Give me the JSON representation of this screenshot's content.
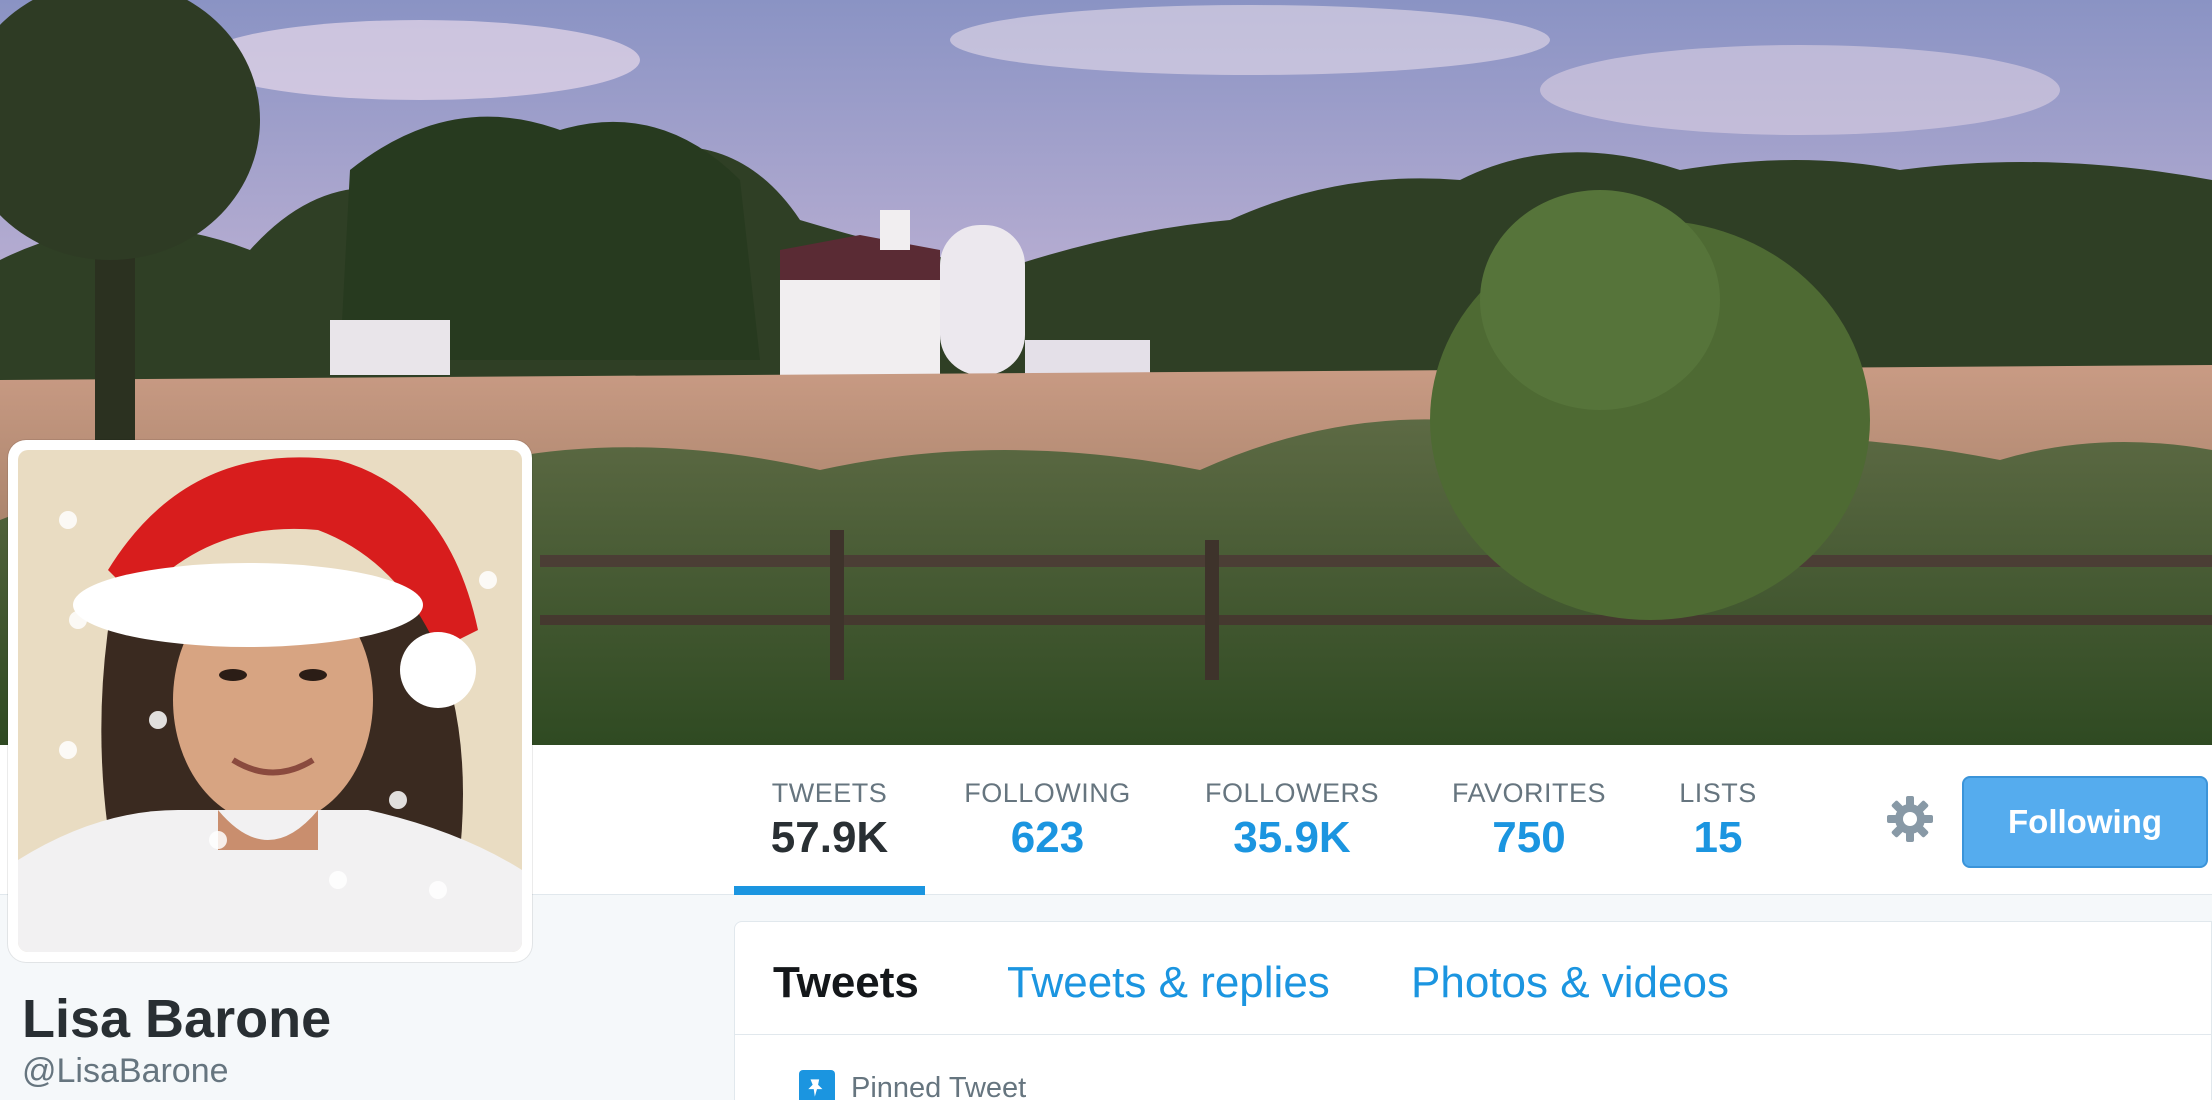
{
  "profile": {
    "name": "Lisa Barone",
    "handle": "@LisaBarone"
  },
  "stats": [
    {
      "label": "TWEETS",
      "value": "57.9K",
      "active": true
    },
    {
      "label": "FOLLOWING",
      "value": "623",
      "active": false
    },
    {
      "label": "FOLLOWERS",
      "value": "35.9K",
      "active": false
    },
    {
      "label": "FAVORITES",
      "value": "750",
      "active": false
    },
    {
      "label": "LISTS",
      "value": "15",
      "active": false
    }
  ],
  "actions": {
    "follow_label": "Following",
    "settings_icon": "gear-icon"
  },
  "timeline": {
    "tabs": [
      {
        "label": "Tweets",
        "active": true
      },
      {
        "label": "Tweets & replies",
        "active": false
      },
      {
        "label": "Photos & videos",
        "active": false
      }
    ],
    "pinned_label": "Pinned Tweet",
    "pinned_icon": "pin-icon"
  },
  "colors": {
    "accent": "#1b95e0",
    "button": "#55acee",
    "text_dark": "#292f33",
    "text_muted": "#66757f"
  }
}
